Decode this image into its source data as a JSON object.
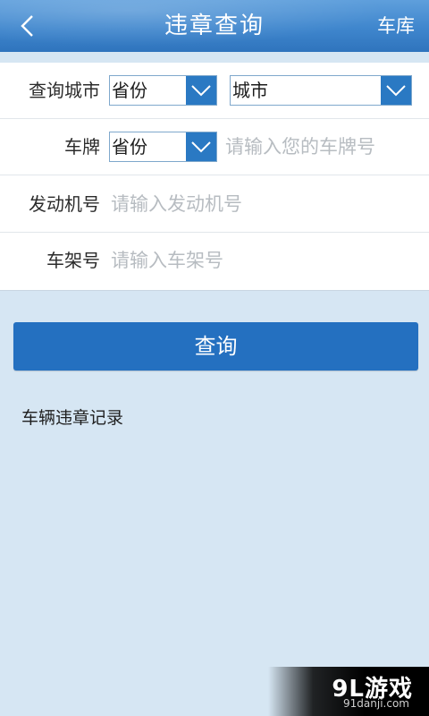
{
  "header": {
    "title": "违章查询",
    "back_icon": "chevron-left-icon",
    "garage_label": "车库"
  },
  "form": {
    "city_row": {
      "label": "查询城市",
      "province_select": "省份",
      "city_select": "城市"
    },
    "plate_row": {
      "label": "车牌",
      "province_select": "省份",
      "plate_placeholder": "请输入您的车牌号"
    },
    "engine_row": {
      "label": "发动机号",
      "placeholder": "请输入发动机号"
    },
    "frame_row": {
      "label": "车架号",
      "placeholder": "请输入车架号"
    }
  },
  "query_button": "查询",
  "records_label": "车辆违章记录",
  "watermark": {
    "logo": "9L游戏",
    "url": "91danji.com"
  },
  "colors": {
    "header": "#3f86cd",
    "accent": "#2470c0",
    "background": "#d6e6f3"
  }
}
